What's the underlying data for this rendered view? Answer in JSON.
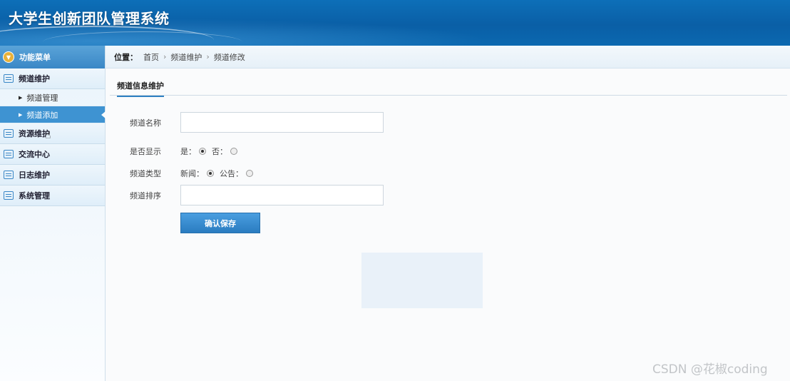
{
  "app": {
    "title": "大学生创新团队管理系统"
  },
  "sidebar": {
    "header": "功能菜单",
    "groups": [
      {
        "label": "频道维护",
        "items": [
          {
            "label": "频道管理"
          },
          {
            "label": "频道添加",
            "active": true
          }
        ]
      },
      {
        "label": "资源维护"
      },
      {
        "label": "交流中心"
      },
      {
        "label": "日志维护"
      },
      {
        "label": "系统管理"
      }
    ]
  },
  "breadcrumb": {
    "label": "位置：",
    "items": [
      "首页",
      "频道维护",
      "频道修改"
    ],
    "separator": "›"
  },
  "tab": {
    "label": "频道信息维护"
  },
  "form": {
    "name_label": "频道名称",
    "name_value": "",
    "display_label": "是否显示",
    "display_options": [
      {
        "label": "是：",
        "checked": true
      },
      {
        "label": "否：",
        "checked": false
      }
    ],
    "type_label": "频道类型",
    "type_options": [
      {
        "label": "新闻：",
        "checked": true
      },
      {
        "label": "公告：",
        "checked": false
      }
    ],
    "order_label": "频道排序",
    "order_value": "",
    "save_label": "确认保存"
  },
  "watermark": "CSDN @花椒coding",
  "colors": {
    "header_bg": "#0a5fa6",
    "menu_header": "#3a87c6",
    "active_item": "#3e93d2",
    "button": "#2a7cc0"
  }
}
